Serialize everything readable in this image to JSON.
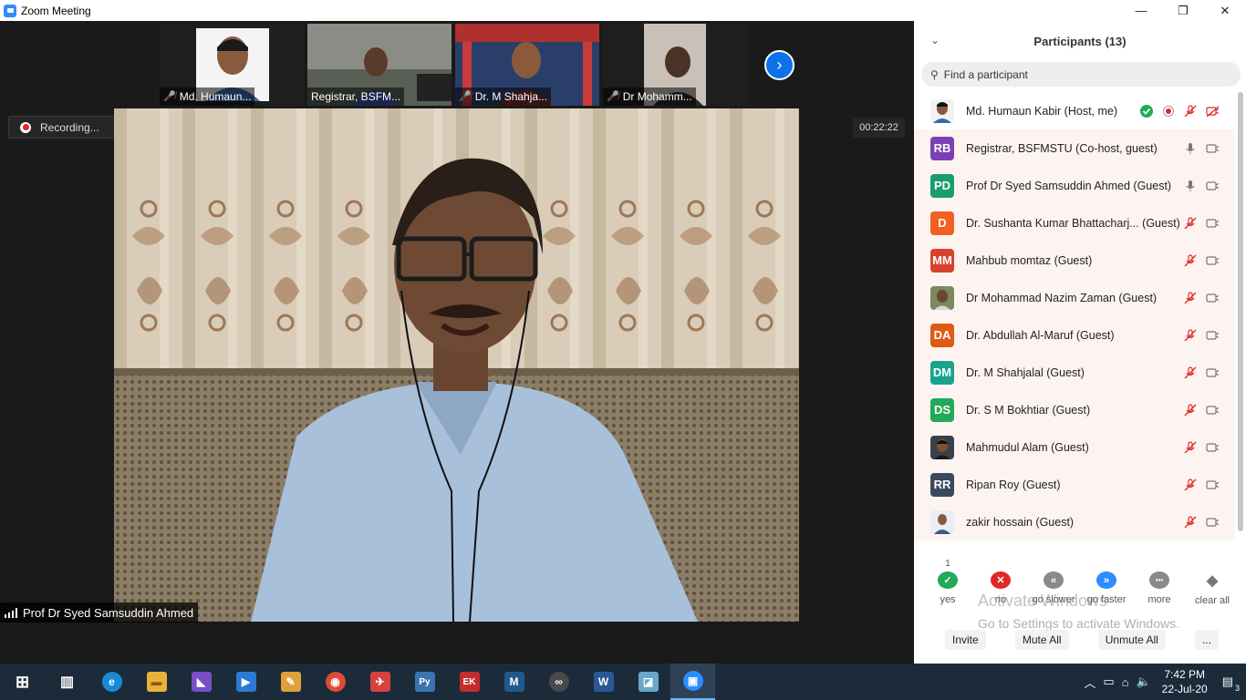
{
  "window": {
    "title": "Zoom Meeting",
    "minimize": "—",
    "maximize": "❐",
    "close": "✕"
  },
  "thumbnails": [
    {
      "label": "Md. Humaun...",
      "muted": true
    },
    {
      "label": "Registrar, BSFM...",
      "muted": false
    },
    {
      "label": "Dr. M Shahja...",
      "muted": true
    },
    {
      "label": "Dr Mohamm...",
      "muted": true
    }
  ],
  "recording": {
    "label": "Recording..."
  },
  "timer": "00:22:22",
  "speaker": {
    "name": "Prof Dr Syed Samsuddin Ahmed"
  },
  "panel": {
    "title": "Participants (13)",
    "search_placeholder": "Find a participant",
    "participants": [
      {
        "initials": "",
        "color": "#ffffff",
        "photo": true,
        "name": "Md. Humaun Kabir (Host, me)"
      },
      {
        "initials": "RB",
        "color": "#7b3fb6",
        "photo": false,
        "name": "Registrar, BSFMSTU (Co-host, guest)"
      },
      {
        "initials": "PD",
        "color": "#1a9c6e",
        "photo": false,
        "name": "Prof Dr Syed Samsuddin Ahmed (Guest)"
      },
      {
        "initials": "D",
        "color": "#f26022",
        "photo": false,
        "name": "Dr. Sushanta Kumar Bhattacharj... (Guest)"
      },
      {
        "initials": "MM",
        "color": "#d9412d",
        "photo": false,
        "name": "Mahbub momtaz (Guest)"
      },
      {
        "initials": "",
        "color": "#5a7a4a",
        "photo": true,
        "name": "Dr Mohammad Nazim Zaman (Guest)"
      },
      {
        "initials": "DA",
        "color": "#e05a16",
        "photo": false,
        "name": "Dr. Abdullah Al-Maruf (Guest)"
      },
      {
        "initials": "DM",
        "color": "#1aa38c",
        "photo": false,
        "name": "Dr. M Shahjalal (Guest)"
      },
      {
        "initials": "DS",
        "color": "#23a95a",
        "photo": false,
        "name": "Dr. S M Bokhtiar (Guest)"
      },
      {
        "initials": "",
        "color": "#4a5560",
        "photo": true,
        "name": "Mahmudul Alam (Guest)"
      },
      {
        "initials": "RR",
        "color": "#3a4a5e",
        "photo": false,
        "name": "Ripan Roy (Guest)"
      },
      {
        "initials": "",
        "color": "#6a8ab0",
        "photo": true,
        "name": "zakir hossain (Guest)"
      }
    ],
    "reactions": [
      {
        "label": "yes",
        "symbol": "✓",
        "color": "#23a95a",
        "count": "1"
      },
      {
        "label": "no",
        "symbol": "✕",
        "color": "#e02828",
        "count": ""
      },
      {
        "label": "go slower",
        "symbol": "«",
        "color": "#8a8a8a",
        "count": ""
      },
      {
        "label": "go faster",
        "symbol": "»",
        "color": "#2d8cff",
        "count": ""
      },
      {
        "label": "more",
        "symbol": "•••",
        "color": "#8a8a8a",
        "count": ""
      },
      {
        "label": "clear all",
        "symbol": "◆",
        "color": "#ffffff",
        "count": ""
      }
    ],
    "buttons": {
      "invite": "Invite",
      "mute_all": "Mute All",
      "unmute_all": "Unmute All",
      "more": "..."
    }
  },
  "watermark": {
    "line1": "Activate Windows",
    "line2": "Go to Settings to activate Windows."
  },
  "taskbar": {
    "apps": [
      {
        "name": "start",
        "glyph": "⊞",
        "color": "#1b2b3a"
      },
      {
        "name": "task-view",
        "glyph": "▥",
        "color": "#1b2b3a"
      },
      {
        "name": "edge",
        "glyph": "e",
        "color": "#1b8ad6"
      },
      {
        "name": "file-explorer",
        "glyph": "▬",
        "color": "#e8b23a"
      },
      {
        "name": "visual-studio",
        "glyph": "◣",
        "color": "#7a4ec4"
      },
      {
        "name": "media-player",
        "glyph": "▶",
        "color": "#2a7ad6"
      },
      {
        "name": "paint",
        "glyph": "✎",
        "color": "#e2a03a"
      },
      {
        "name": "chrome",
        "glyph": "◉",
        "color": "#dd4b39"
      },
      {
        "name": "satellite-app",
        "glyph": "✈",
        "color": "#d94040"
      },
      {
        "name": "python",
        "glyph": "Py",
        "color": "#3a74b0"
      },
      {
        "name": "ek-app",
        "glyph": "EK",
        "color": "#c32d2d"
      },
      {
        "name": "matlab",
        "glyph": "M",
        "color": "#1f5a8a"
      },
      {
        "name": "arduino",
        "glyph": "∞",
        "color": "#4a4a4a"
      },
      {
        "name": "word",
        "glyph": "W",
        "color": "#2b5797"
      },
      {
        "name": "sketch-app",
        "glyph": "◪",
        "color": "#6aa7c8"
      },
      {
        "name": "zoom",
        "glyph": "▣",
        "color": "#2d8cff"
      }
    ],
    "time": "7:42 PM",
    "date": "22-Jul-20",
    "notifications": "3"
  }
}
